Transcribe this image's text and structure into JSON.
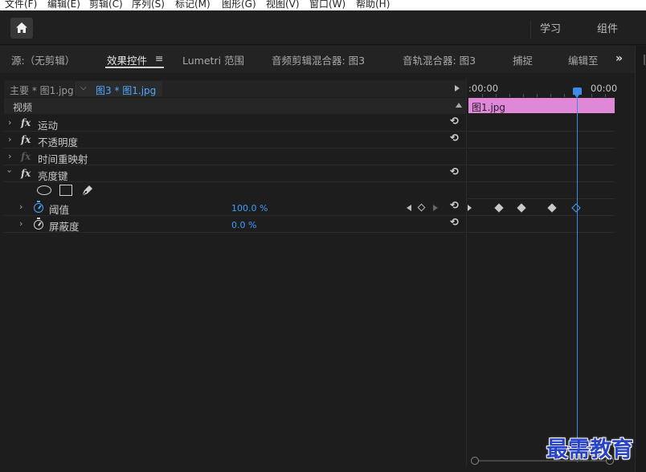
{
  "menu": [
    "文件(F)",
    "编辑(E)",
    "剪辑(C)",
    "序列(S)",
    "标记(M)",
    "图形(G)",
    "视图(V)",
    "窗口(W)",
    "帮助(H)"
  ],
  "workspaces": [
    "学习",
    "组件"
  ],
  "tabs": [
    "源:（无剪辑）",
    "效果控件",
    "Lumetri 范围",
    "音频剪辑混合器: 图3",
    "音轨混合器: 图3",
    "捕捉",
    "编辑至"
  ],
  "tab_menu_icon": "≡",
  "more_label": "»",
  "source": {
    "master": "主要 * 图1.jpg",
    "clip": "图3 * 图1.jpg",
    "dropdown": "⌵"
  },
  "section": "视频",
  "effects": [
    {
      "name": "运动"
    },
    {
      "name": "不透明度"
    },
    {
      "name": "时间重映射"
    },
    {
      "name": "亮度键"
    }
  ],
  "fx_symbol": "fx",
  "params": [
    {
      "name": "阈值",
      "value": "100.0 %"
    },
    {
      "name": "屏蔽度",
      "value": "0.0 %"
    }
  ],
  "reset_glyph": "⟲",
  "timeline": {
    "time_start": ":00:00",
    "time_end": "00:00",
    "clip_label": "图1.jpg"
  },
  "watermark": "最需教育",
  "icons": [
    "home-icon",
    "chevron-icon",
    "fx-icon",
    "reset-icon",
    "stopwatch-icon",
    "ellipse-mask-icon",
    "rectangle-mask-icon",
    "pen-mask-icon",
    "keyframe-icon",
    "playhead-icon"
  ]
}
